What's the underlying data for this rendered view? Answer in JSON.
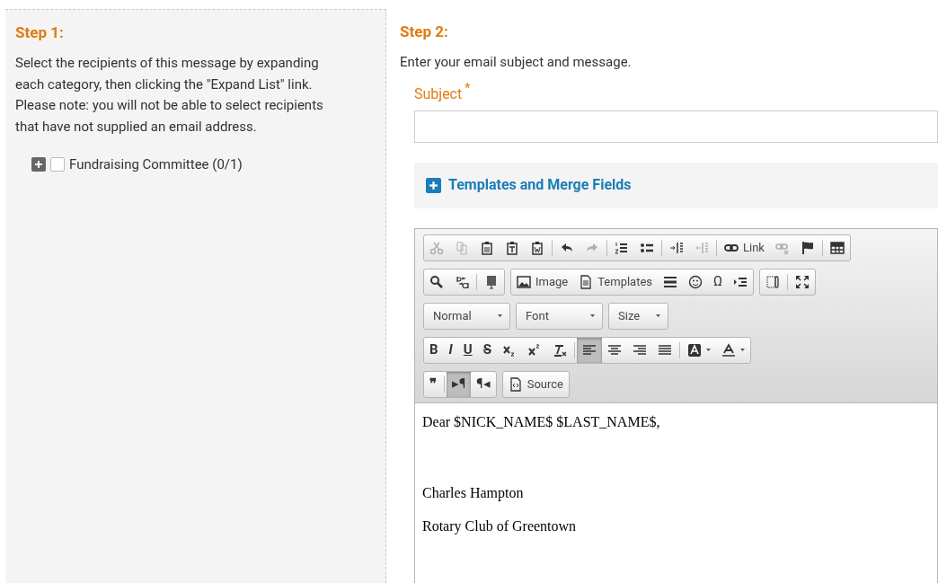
{
  "step1": {
    "heading": "Step 1:",
    "instructions": "Select the recipients of this message by expanding each category, then clicking the \"Expand List\" link. Please note: you will not be able to select recipients that have not supplied an email address.",
    "categories": [
      {
        "label": "Fundraising Committee (0/1)",
        "checked": false,
        "expanded": false
      }
    ]
  },
  "step2": {
    "heading": "Step 2:",
    "instructions": "Enter your email subject and message.",
    "subject_label": "Subject",
    "required_mark": "*",
    "templates_label": "Templates and Merge Fields",
    "templates_expanded": false
  },
  "toolbar": [
    {
      "groups": [
        {
          "sections": [
            {
              "buttons": [
                {
                  "kind": "cut",
                  "disabled": true,
                  "on": false
                },
                {
                  "kind": "copy",
                  "disabled": true,
                  "on": false
                },
                {
                  "kind": "paste",
                  "disabled": false,
                  "on": false
                },
                {
                  "kind": "paste-text",
                  "disabled": false,
                  "on": false
                },
                {
                  "kind": "paste-word",
                  "disabled": false,
                  "on": false
                }
              ]
            },
            {
              "buttons": [
                {
                  "kind": "undo",
                  "disabled": false,
                  "on": false
                },
                {
                  "kind": "redo",
                  "disabled": true,
                  "on": false
                }
              ]
            },
            {
              "buttons": [
                {
                  "kind": "numbered-list",
                  "disabled": false,
                  "on": false
                },
                {
                  "kind": "bulleted-list",
                  "disabled": false,
                  "on": false
                }
              ]
            },
            {
              "buttons": [
                {
                  "kind": "outdent",
                  "disabled": false,
                  "on": false
                },
                {
                  "kind": "indent",
                  "disabled": true,
                  "on": false
                }
              ]
            },
            {
              "buttons": [
                {
                  "kind": "link",
                  "label": "Link",
                  "disabled": false,
                  "on": false
                },
                {
                  "kind": "unlink",
                  "disabled": true,
                  "on": false
                },
                {
                  "kind": "flag",
                  "disabled": false,
                  "on": false
                }
              ]
            },
            {
              "buttons": [
                {
                  "kind": "table",
                  "disabled": false,
                  "on": false
                }
              ]
            }
          ]
        }
      ]
    },
    {
      "groups": [
        {
          "sections": [
            {
              "buttons": [
                {
                  "kind": "search",
                  "disabled": false,
                  "on": false
                },
                {
                  "kind": "replace",
                  "disabled": false,
                  "on": false
                }
              ]
            },
            {
              "buttons": [
                {
                  "kind": "form",
                  "disabled": false,
                  "on": false
                }
              ]
            }
          ]
        },
        {
          "sections": [
            {
              "buttons": [
                {
                  "kind": "image",
                  "label": "Image",
                  "disabled": false,
                  "on": false
                },
                {
                  "kind": "document",
                  "label": "Templates",
                  "disabled": false,
                  "on": false
                },
                {
                  "kind": "rule",
                  "disabled": false,
                  "on": false
                },
                {
                  "kind": "smiley",
                  "disabled": false,
                  "on": false
                },
                {
                  "kind": "char",
                  "label": "Ω",
                  "disabled": false,
                  "on": false
                },
                {
                  "kind": "pagebreak",
                  "disabled": false,
                  "on": false
                }
              ]
            }
          ]
        },
        {
          "sections": [
            {
              "buttons": [
                {
                  "kind": "blocks",
                  "disabled": false,
                  "on": false
                }
              ]
            },
            {
              "buttons": [
                {
                  "kind": "maximize",
                  "disabled": false,
                  "on": false
                }
              ]
            }
          ]
        }
      ]
    },
    {
      "combos": [
        {
          "label": "Normal"
        },
        {
          "label": "Font"
        },
        {
          "label": "Size"
        }
      ]
    },
    {
      "groups": [
        {
          "sections": [
            {
              "buttons": [
                {
                  "kind": "bold",
                  "label": "B",
                  "disabled": false,
                  "on": false
                },
                {
                  "kind": "italic",
                  "label": "I",
                  "disabled": false,
                  "on": false
                },
                {
                  "kind": "underline",
                  "label": "U",
                  "disabled": false,
                  "on": false
                },
                {
                  "kind": "strike",
                  "label": "S",
                  "disabled": false,
                  "on": false
                },
                {
                  "kind": "subscript",
                  "disabled": false,
                  "on": false
                },
                {
                  "kind": "superscript",
                  "disabled": false,
                  "on": false
                },
                {
                  "kind": "clear-format",
                  "disabled": false,
                  "on": false
                }
              ]
            },
            {
              "buttons": [
                {
                  "kind": "align-left",
                  "disabled": false,
                  "on": true
                },
                {
                  "kind": "align-center",
                  "disabled": false,
                  "on": false
                },
                {
                  "kind": "align-right",
                  "disabled": false,
                  "on": false
                },
                {
                  "kind": "justify",
                  "disabled": false,
                  "on": false
                }
              ]
            },
            {
              "buttons": [
                {
                  "kind": "bg-color",
                  "disabled": false,
                  "on": false
                },
                {
                  "kind": "text-color",
                  "disabled": false,
                  "on": false
                }
              ]
            }
          ]
        }
      ]
    },
    {
      "groups": [
        {
          "sections": [
            {
              "buttons": [
                {
                  "kind": "bold",
                  "label": "❞",
                  "disabled": false,
                  "on": false
                }
              ]
            },
            {
              "buttons": [
                {
                  "kind": "char",
                  "label": "▸¶",
                  "disabled": false,
                  "on": true
                },
                {
                  "kind": "char",
                  "label": "¶◂",
                  "disabled": false,
                  "on": false
                }
              ]
            }
          ]
        },
        {
          "sections": [
            {
              "buttons": [
                {
                  "kind": "source",
                  "label": "Source",
                  "disabled": false,
                  "on": false
                }
              ]
            }
          ]
        }
      ]
    }
  ],
  "editor": {
    "paragraphs": [
      {
        "kind": "line",
        "text": "Dear $NICK_NAME$ $LAST_NAME$,"
      },
      {
        "kind": "after-blank",
        "text": "Charles Hampton"
      },
      {
        "kind": "line",
        "text": "Rotary Club of Greentown"
      }
    ]
  }
}
